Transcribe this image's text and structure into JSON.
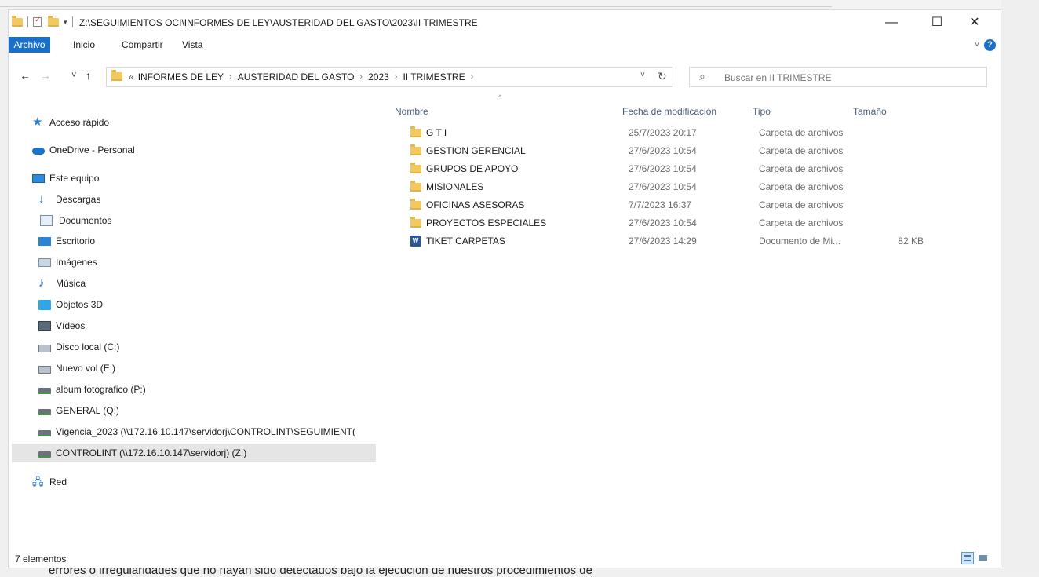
{
  "window": {
    "title_path": "Z:\\SEGUIMIENTOS OCI\\INFORMES DE LEY\\AUSTERIDAD DEL GASTO\\2023\\II TRIMESTRE",
    "minimize": "—",
    "maximize": "☐",
    "close": "✕"
  },
  "ribbon": {
    "tabs": [
      "Archivo",
      "Inicio",
      "Compartir",
      "Vista"
    ],
    "help": "?"
  },
  "nav": {
    "back": "←",
    "forward": "→",
    "recent": "˅",
    "up": "↑",
    "overflow": "«",
    "breadcrumbs": [
      "INFORMES DE LEY",
      "AUSTERIDAD DEL GASTO",
      "2023",
      "II TRIMESTRE"
    ],
    "crumb_separator": "›",
    "dropdown": "˅",
    "refresh": "↻",
    "search_placeholder": "Buscar en II TRIMESTRE"
  },
  "sidebar": {
    "items": [
      {
        "label": "Acceso rápido",
        "icon": "star-icon"
      },
      {
        "label": "OneDrive - Personal",
        "icon": "cloud-icon"
      },
      {
        "label": "Este equipo",
        "icon": "computer-icon"
      },
      {
        "label": "Descargas",
        "icon": "download-icon"
      },
      {
        "label": "Documentos",
        "icon": "document-icon"
      },
      {
        "label": "Escritorio",
        "icon": "desktop-icon"
      },
      {
        "label": "Imágenes",
        "icon": "image-icon"
      },
      {
        "label": "Música",
        "icon": "music-icon"
      },
      {
        "label": "Objetos 3D",
        "icon": "cube-icon"
      },
      {
        "label": "Vídeos",
        "icon": "video-icon"
      },
      {
        "label": "Disco local (C:)",
        "icon": "disk-icon"
      },
      {
        "label": "Nuevo vol (E:)",
        "icon": "drive-icon"
      },
      {
        "label": "album fotografico (P:)",
        "icon": "network-drive-icon"
      },
      {
        "label": "GENERAL (Q:)",
        "icon": "network-drive-icon"
      },
      {
        "label": "Vigencia_2023 (\\\\172.16.10.147\\servidorj\\CONTROLINT\\SEGUIMIENT(",
        "icon": "network-drive-icon"
      },
      {
        "label": "CONTROLINT (\\\\172.16.10.147\\servidorj) (Z:)",
        "icon": "network-drive-icon",
        "selected": true
      },
      {
        "label": "Red",
        "icon": "network-icon"
      }
    ]
  },
  "files": {
    "columns": [
      "Nombre",
      "Fecha de modificación",
      "Tipo",
      "Tamaño"
    ],
    "sort_indicator": "^",
    "rows": [
      {
        "name": "G T I",
        "date": "25/7/2023 20:17",
        "type": "Carpeta de archivos",
        "size": "",
        "icon": "folder-icon"
      },
      {
        "name": "GESTION GERENCIAL",
        "date": "27/6/2023 10:54",
        "type": "Carpeta de archivos",
        "size": "",
        "icon": "folder-icon"
      },
      {
        "name": "GRUPOS DE APOYO",
        "date": "27/6/2023 10:54",
        "type": "Carpeta de archivos",
        "size": "",
        "icon": "folder-icon"
      },
      {
        "name": "MISIONALES",
        "date": "27/6/2023 10:54",
        "type": "Carpeta de archivos",
        "size": "",
        "icon": "folder-icon"
      },
      {
        "name": "OFICINAS ASESORAS",
        "date": "7/7/2023 16:37",
        "type": "Carpeta de archivos",
        "size": "",
        "icon": "folder-icon"
      },
      {
        "name": "PROYECTOS ESPECIALES",
        "date": "27/6/2023 10:54",
        "type": "Carpeta de archivos",
        "size": "",
        "icon": "folder-icon"
      },
      {
        "name": "TIKET CARPETAS",
        "date": "27/6/2023 14:29",
        "type": "Documento de Mi...",
        "size": "82 KB",
        "icon": "word-document-icon"
      }
    ]
  },
  "status": {
    "count": "7 elementos"
  },
  "background_text": "errores o irregularidades que no hayan sido detectados bajo la ejecución de nuestros procedimientos de",
  "colors": {
    "accent": "#1a6fc8",
    "folder": "#f4c860",
    "selection": "#e5e5e5"
  }
}
